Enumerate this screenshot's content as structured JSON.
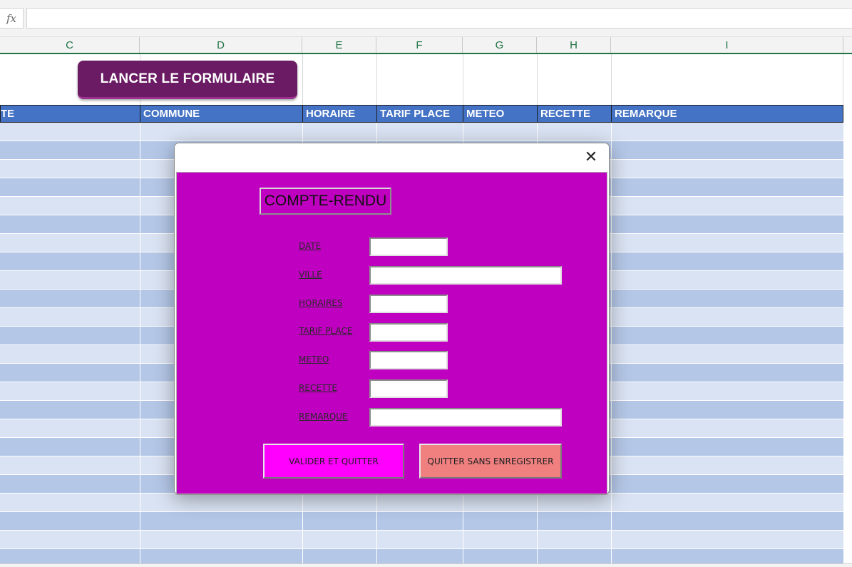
{
  "formula_bar": {
    "fx_label": "fx",
    "value": ""
  },
  "columns": [
    "C",
    "D",
    "E",
    "F",
    "G",
    "H",
    "I"
  ],
  "launch_button": "LANCER LE FORMULAIRE",
  "table": {
    "headers": [
      "TE",
      "COMMUNE",
      "HORAIRE",
      "TARIF PLACE",
      "METEO",
      "RECETTE",
      "REMARQUE"
    ]
  },
  "dialog": {
    "close_glyph": "✕",
    "title": "COMPTE-RENDU",
    "fields": [
      {
        "label": "DATE",
        "value": ""
      },
      {
        "label": "VILLE",
        "value": ""
      },
      {
        "label": "HORAIRES",
        "value": ""
      },
      {
        "label": "TARIF PLACE",
        "value": ""
      },
      {
        "label": "METEO",
        "value": ""
      },
      {
        "label": "RECETTE",
        "value": ""
      },
      {
        "label": "REMARQUE",
        "value": ""
      }
    ],
    "valider_label": "VALIDER ET QUITTER",
    "quitter_label": "QUITTER SANS ENREGISTRER"
  },
  "colors": {
    "table_header": "#4472c4",
    "row_light": "#dae3f3",
    "row_dark": "#b4c7e7",
    "launch_button": "#6a1b63",
    "dialog_body": "#c000c0",
    "valider_button": "#ff00ff",
    "quitter_button": "#f08080"
  }
}
